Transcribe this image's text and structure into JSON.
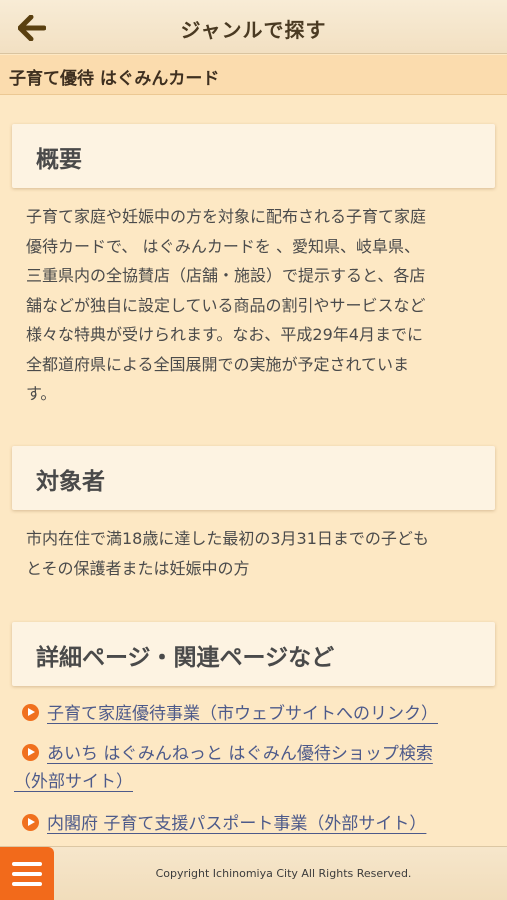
{
  "header": {
    "title": "ジャンルで探す",
    "back_icon": "back-arrow-icon"
  },
  "subtitle": "子育て優待 はぐみんカード",
  "sections": {
    "overview": {
      "title": "概要",
      "lines": [
        "子育て家庭や妊娠中の方を対象に配布される子育て家庭",
        "優待カードで、 はぐみんカードを 、愛知県、岐阜県、",
        "三重県内の全協賛店（店舗・施設）で提示すると、各店",
        "舗などが独自に設定している商品の割引やサービスなど",
        "様々な特典が受けられます。なお、平成29年4月までに",
        "全都道府県による全国展開での実施が予定されていま",
        "す。"
      ]
    },
    "target": {
      "title": "対象者",
      "lines": [
        "市内在住で満18歳に達した最初の3月31日までの子ども",
        "とその保護者または妊娠中の方"
      ]
    },
    "details": {
      "title": "詳細ページ・関連ページなど",
      "links": [
        {
          "line1": "子育て家庭優待事業（市ウェブサイトへのリンク）",
          "line2": ""
        },
        {
          "line1": "あいち はぐみんねっと はぐみん優待ショップ検索",
          "line2": "（外部サイト）"
        },
        {
          "line1": "内閣府 子育て支援パスポート事業（外部サイト）",
          "line2": ""
        }
      ]
    }
  },
  "footer": {
    "copyright": "Copyright Ichinomiya City All Rights Reserved.",
    "menu_icon": "hamburger-menu-icon"
  },
  "colors": {
    "background": "#fde8c4",
    "accent": "#f26a1b",
    "link": "#4d5a8a"
  }
}
